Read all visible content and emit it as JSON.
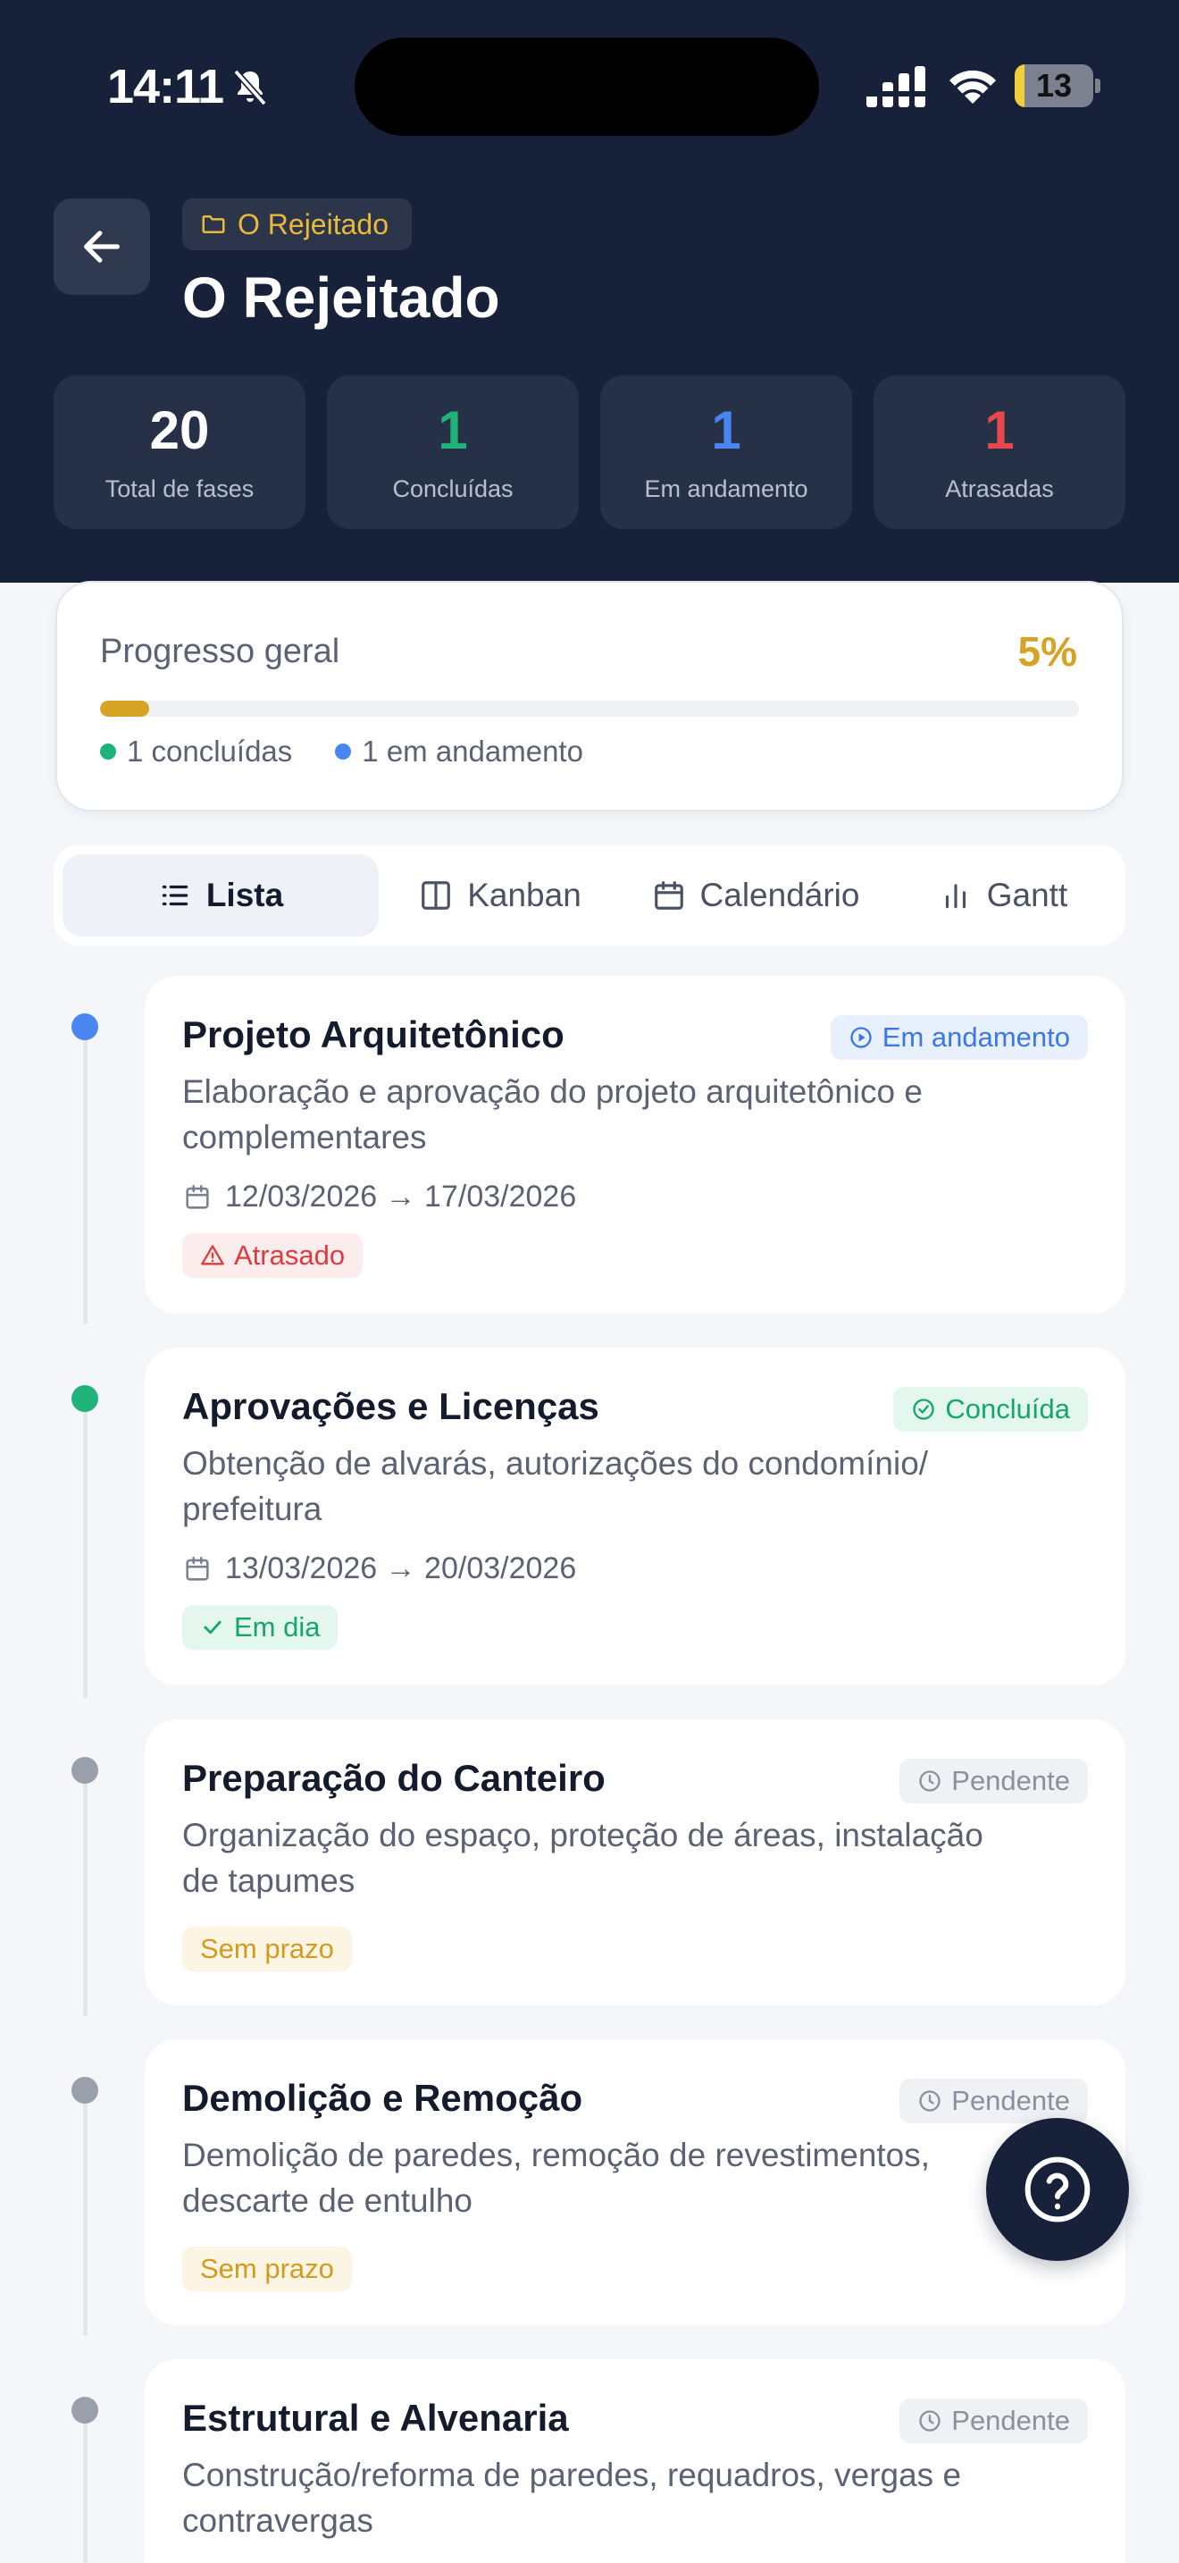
{
  "status_bar": {
    "time": "14:11",
    "battery": "13",
    "battery_level": 0.13
  },
  "header": {
    "breadcrumb": "O Rejeitado",
    "title": "O Rejeitado"
  },
  "stats": [
    {
      "value": "20",
      "label": "Total de fases",
      "color": "#ffffff"
    },
    {
      "value": "1",
      "label": "Concluídas",
      "color": "#1fb37a"
    },
    {
      "value": "1",
      "label": "Em andamento",
      "color": "#4a86f0"
    },
    {
      "value": "1",
      "label": "Atrasadas",
      "color": "#e5484d"
    }
  ],
  "progress": {
    "label": "Progresso geral",
    "percent_text": "5%",
    "percent": 5,
    "legend_done": "1 concluídas",
    "legend_progress": "1 em andamento"
  },
  "tabs": [
    {
      "label": "Lista",
      "icon": "list-icon",
      "active": true
    },
    {
      "label": "Kanban",
      "icon": "kanban-icon",
      "active": false
    },
    {
      "label": "Calendário",
      "icon": "calendar-icon",
      "active": false
    },
    {
      "label": "Gantt",
      "icon": "gantt-chart-icon",
      "active": false
    }
  ],
  "phases": [
    {
      "title": "Projeto Arquitetônico",
      "status": "Em andamento",
      "description": "Elaboração e aprovação do projeto arquitetônico e complementares",
      "date_range": "12/03/2026 → 17/03/2026",
      "tag": "Atrasado"
    },
    {
      "title": "Aprovações e Licenças",
      "status": "Concluída",
      "description": "Obtenção de alvarás, autorizações do condomínio/ prefeitura",
      "date_range": "13/03/2026 → 20/03/2026",
      "tag": "Em dia"
    },
    {
      "title": "Preparação do Canteiro",
      "status": "Pendente",
      "description": "Organização do espaço, proteção de áreas, instalação de tapumes",
      "tag": "Sem prazo"
    },
    {
      "title": "Demolição e Remoção",
      "status": "Pendente",
      "description": "Demolição de paredes, remoção de revestimentos, descarte de entulho",
      "tag": "Sem prazo"
    },
    {
      "title": "Estrutural e Alvenaria",
      "status": "Pendente",
      "description": "Construção/reforma de paredes, requadros, vergas e contravergas"
    }
  ],
  "colors": {
    "header_bg": "#17223a",
    "accent": "#d6a324",
    "done": "#1fb37a",
    "in_progress": "#4a86f0",
    "late": "#e5484d",
    "pending": "#9aa0ab"
  }
}
